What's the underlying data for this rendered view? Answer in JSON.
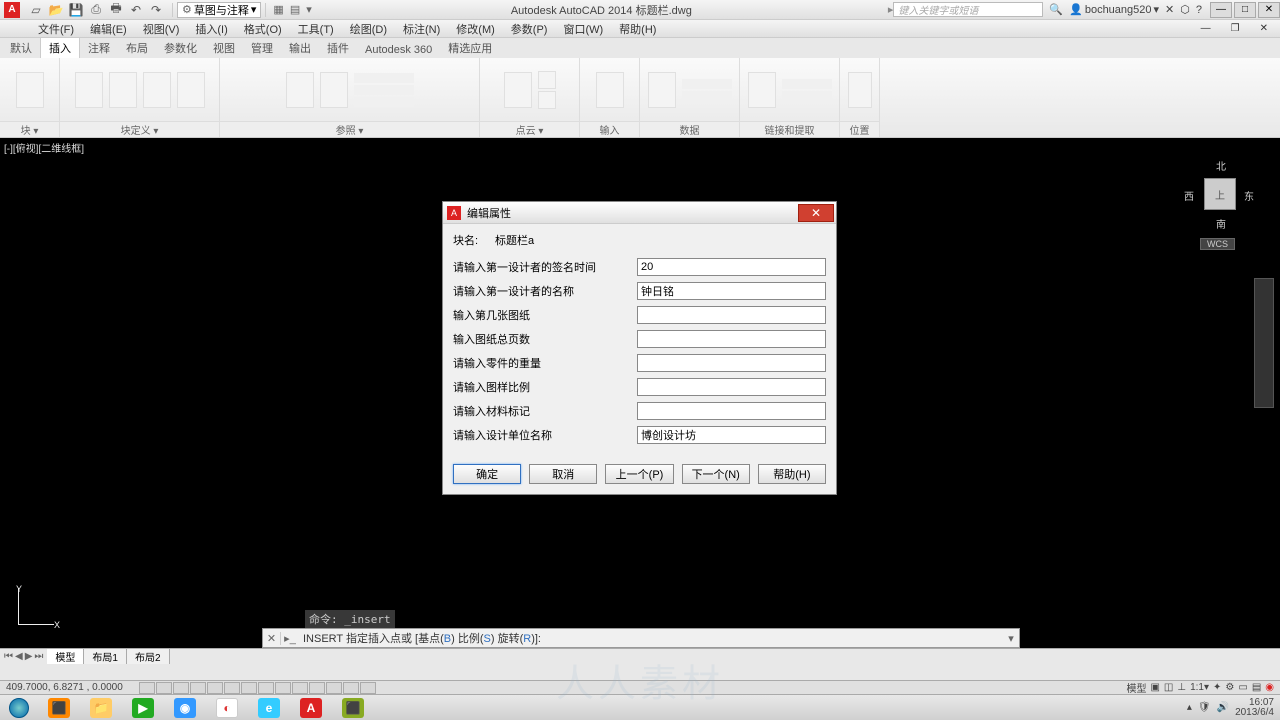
{
  "titlebar": {
    "workspace": "草图与注释",
    "app_title": "Autodesk AutoCAD 2014   标题栏.dwg",
    "search_placeholder": "键入关键字或短语",
    "username": "bochuang520"
  },
  "menubar": {
    "items": [
      "文件(F)",
      "编辑(E)",
      "视图(V)",
      "插入(I)",
      "格式(O)",
      "工具(T)",
      "绘图(D)",
      "标注(N)",
      "修改(M)",
      "参数(P)",
      "窗口(W)",
      "帮助(H)"
    ]
  },
  "ribbon_tabs": [
    "默认",
    "插入",
    "注释",
    "布局",
    "参数化",
    "视图",
    "管理",
    "输出",
    "插件",
    "Autodesk 360",
    "精选应用"
  ],
  "ribbon_active": "插入",
  "ribbon_panels": [
    "块 ▾",
    "块定义 ▾",
    "参照 ▾",
    "点云 ▾",
    "输入",
    "数据",
    "链接和提取",
    "位置"
  ],
  "viewport_label": "[-][俯视][二维线框]",
  "viewcube": {
    "n": "北",
    "s": "南",
    "e": "东",
    "w": "西",
    "top": "上",
    "wcs": "WCS"
  },
  "cmd_history": "命令: _insert",
  "cmd_prompt_prefix": "INSERT 指定插入点或 [基点(",
  "cmd_prompt_b": "B",
  "cmd_prompt_mid1": ") 比例(",
  "cmd_prompt_s": "S",
  "cmd_prompt_mid2": ") 旋转(",
  "cmd_prompt_r": "R",
  "cmd_prompt_end": ")]:",
  "model_tabs": [
    "模型",
    "布局1",
    "布局2"
  ],
  "status_coords": "409.7000, 6.8271 , 0.0000",
  "status_right": [
    "模型",
    "▣",
    "◫",
    "⊥",
    "1:1▾",
    "✦",
    "⚙",
    "▭",
    "▤",
    "◉"
  ],
  "dialog": {
    "title": "编辑属性",
    "block_label": "块名:",
    "block_name": "标题栏a",
    "attrs": [
      {
        "label": "请输入第一设计者的签名时间",
        "value": "20"
      },
      {
        "label": "请输入第一设计者的名称",
        "value": "钟日铭"
      },
      {
        "label": "输入第几张图纸",
        "value": ""
      },
      {
        "label": "输入图纸总页数",
        "value": ""
      },
      {
        "label": "请输入零件的重量",
        "value": ""
      },
      {
        "label": "请输入图样比例",
        "value": ""
      },
      {
        "label": "请输入材料标记",
        "value": ""
      },
      {
        "label": "请输入设计单位名称",
        "value": "博创设计坊"
      }
    ],
    "buttons": {
      "ok": "确定",
      "cancel": "取消",
      "prev": "上一个(P)",
      "next": "下一个(N)",
      "help": "帮助(H)"
    }
  },
  "taskbar": {
    "time": "16:07",
    "date": "2013/6/4"
  },
  "watermark": "人人素材"
}
